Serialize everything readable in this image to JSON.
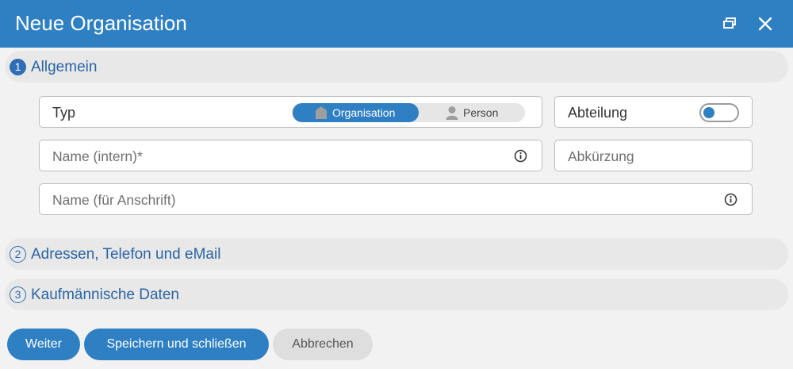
{
  "dialog": {
    "title": "Neue Organisation",
    "icons": {
      "restore": "window-restore-icon",
      "close": "close-icon"
    }
  },
  "sections": [
    {
      "number": "1",
      "label": "Allgemein",
      "expanded": true
    },
    {
      "number": "2",
      "label": "Adressen, Telefon und eMail",
      "expanded": false
    },
    {
      "number": "3",
      "label": "Kaufmännische Daten",
      "expanded": false
    }
  ],
  "form": {
    "type": {
      "label": "Typ",
      "options": [
        "Organisation",
        "Person"
      ],
      "selected": "Organisation",
      "option_icons": [
        "building-icon",
        "person-icon"
      ]
    },
    "department": {
      "label": "Abteilung",
      "enabled": false
    },
    "name_internal": {
      "placeholder": "Name (intern)*",
      "value": ""
    },
    "abbreviation": {
      "placeholder": "Abkürzung",
      "value": ""
    },
    "name_address": {
      "placeholder": "Name (für Anschrift)",
      "value": ""
    }
  },
  "buttons": {
    "next": "Weiter",
    "save_close": "Speichern und schließen",
    "cancel": "Abbrechen"
  },
  "colors": {
    "header": "#2f7fc3",
    "accent": "#2f7fc3",
    "section_label": "#2a64a4",
    "background": "#f2f2f2"
  }
}
